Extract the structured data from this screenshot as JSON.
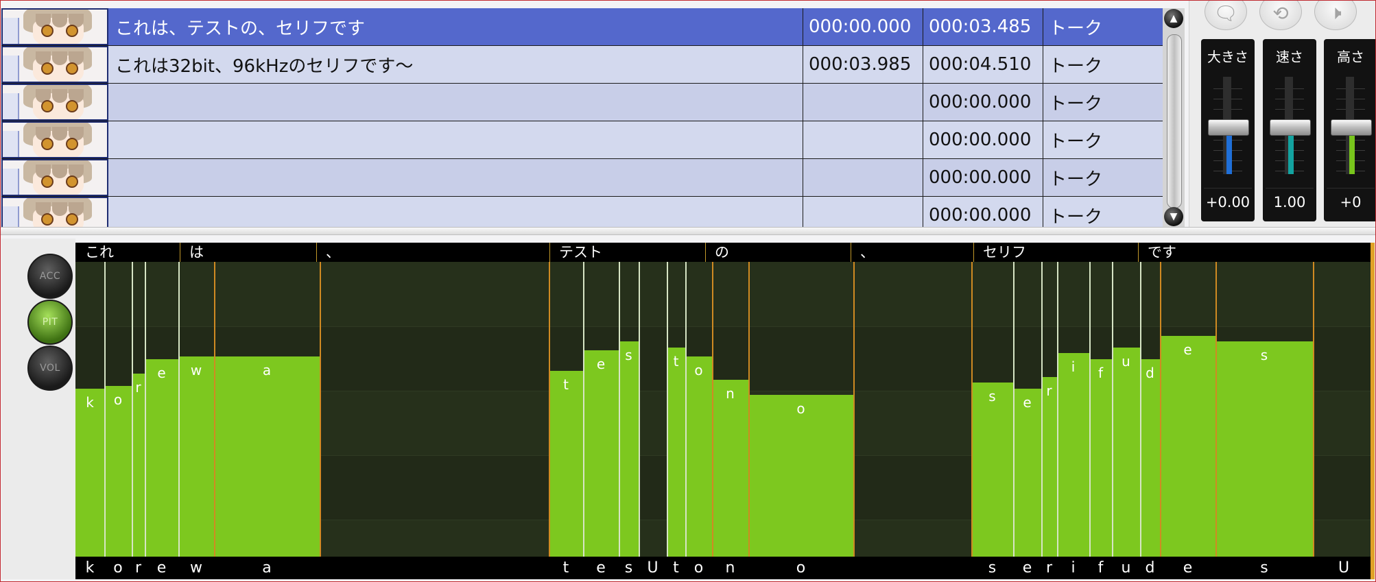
{
  "table": {
    "rows": [
      {
        "text": "これは、テストの、セリフです",
        "start": "000:00.000",
        "end": "000:03.485",
        "type": "トーク",
        "selected": true
      },
      {
        "text": "これは32bit、96kHzのセリフです～",
        "start": "000:03.985",
        "end": "000:04.510",
        "type": "トーク"
      },
      {
        "text": "",
        "start": "",
        "end": "000:00.000",
        "type": "トーク"
      },
      {
        "text": "",
        "start": "",
        "end": "000:00.000",
        "type": "トーク"
      },
      {
        "text": "",
        "start": "",
        "end": "000:00.000",
        "type": "トーク"
      },
      {
        "text": "",
        "start": "",
        "end": "000:00.000",
        "type": "トーク"
      }
    ]
  },
  "right_panel": {
    "buttons": [
      "speech-bubble-icon",
      "repeat-icon",
      "speaker-icon"
    ],
    "sliders": [
      {
        "label": "大きさ",
        "value": "+0.00",
        "fill_color": "#1f6fd8",
        "level": 0.5
      },
      {
        "label": "速さ",
        "value": "1.00",
        "fill_color": "#13a3a0",
        "level": 0.5
      },
      {
        "label": "高さ",
        "value": "+0",
        "fill_color": "#78c51c",
        "level": 0.5
      }
    ]
  },
  "editor": {
    "modes": [
      {
        "label": "ACC",
        "active": false
      },
      {
        "label": "PIT",
        "active": true
      },
      {
        "label": "VOL",
        "active": false
      }
    ],
    "kana": [
      "これ",
      "は",
      "、",
      "テスト",
      "の",
      "、",
      "セリフ",
      "です"
    ],
    "phonemes": [
      "k",
      "o",
      "r",
      "e",
      "w",
      "a",
      "t",
      "e",
      "s",
      "U",
      "t",
      "o",
      "n",
      "o",
      "s",
      "e",
      "r",
      "i",
      "f",
      "u",
      "d",
      "e",
      "s",
      "U"
    ],
    "pitch": [
      0.57,
      0.58,
      0.62,
      0.67,
      0.68,
      0.68,
      0.63,
      0.7,
      0.73,
      0,
      0.71,
      0.68,
      0.6,
      0.55,
      0.59,
      0.57,
      0.61,
      0.69,
      0.67,
      0.71,
      0.67,
      0.75,
      0.73,
      0
    ],
    "accent_color": "#7dc81f"
  }
}
